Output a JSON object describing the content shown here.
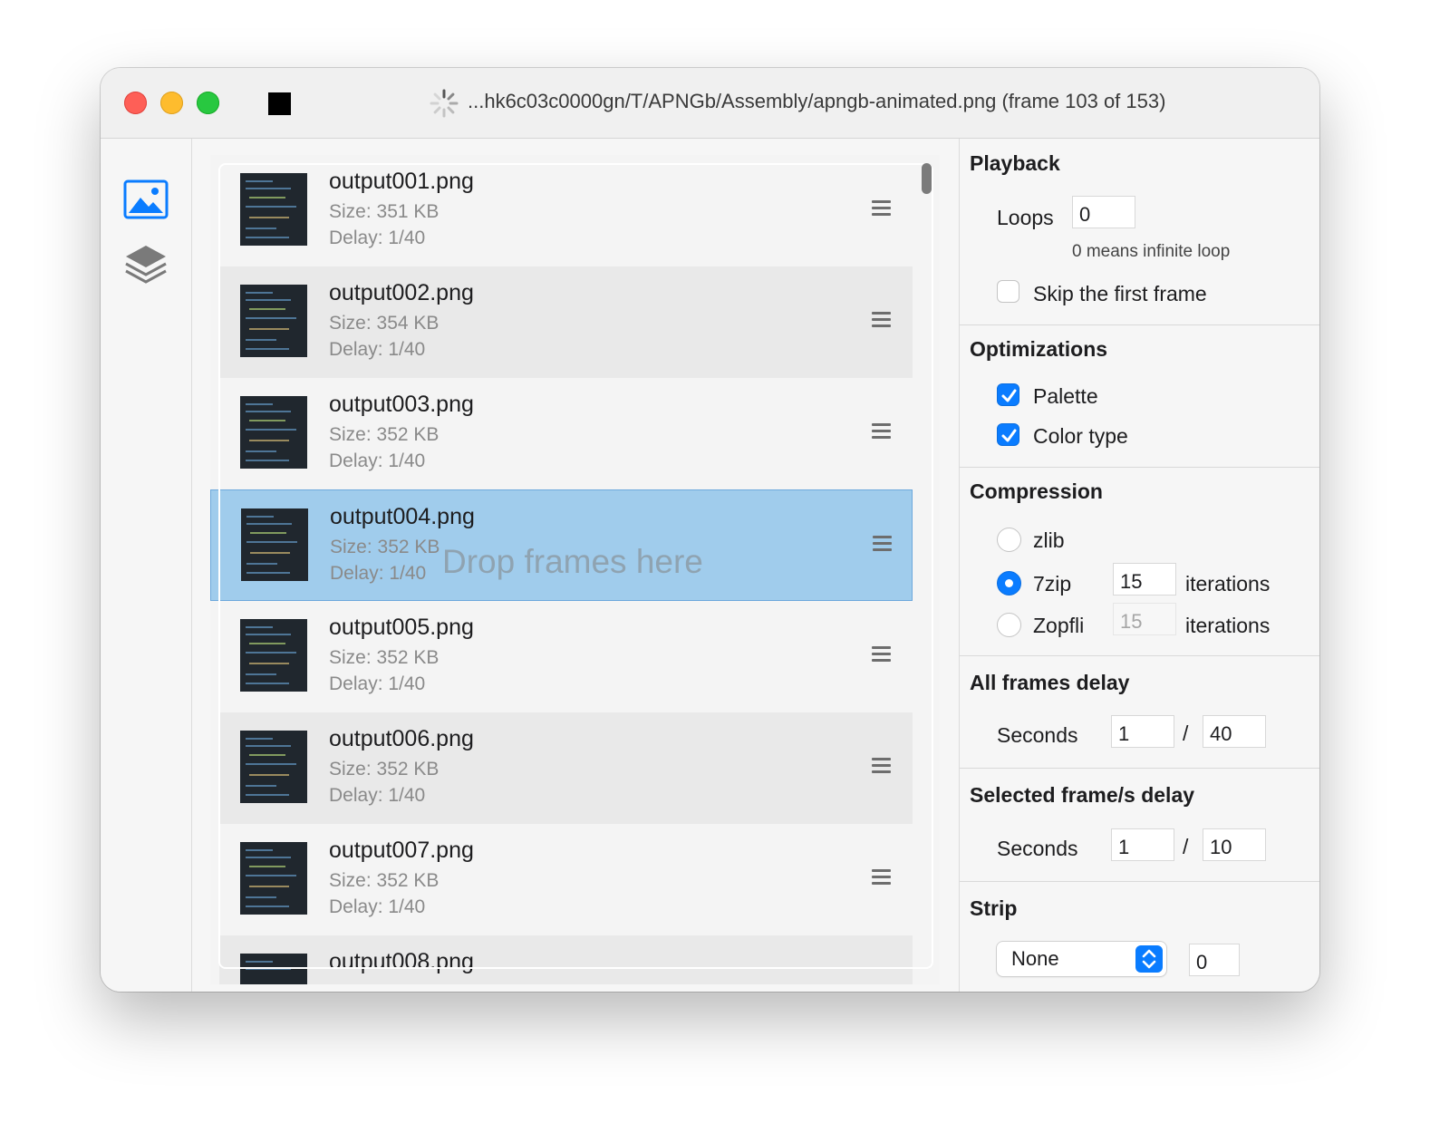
{
  "window": {
    "title": "...hk6c03c0000gn/T/APNGb/Assembly/apngb-animated.png (frame 103 of 153)"
  },
  "sidebar": {
    "items": [
      {
        "icon": "image-icon",
        "selected": true,
        "color": "#0a7cff"
      },
      {
        "icon": "layers-icon",
        "selected": false,
        "color": "#7a7a7a"
      }
    ]
  },
  "frames": {
    "drop_hint": "Drop frames here",
    "items": [
      {
        "name": "output001.png",
        "size": "Size: 351 KB",
        "delay": "Delay: 1/40",
        "selected": false
      },
      {
        "name": "output002.png",
        "size": "Size: 354 KB",
        "delay": "Delay: 1/40",
        "selected": false
      },
      {
        "name": "output003.png",
        "size": "Size: 352 KB",
        "delay": "Delay: 1/40",
        "selected": false
      },
      {
        "name": "output004.png",
        "size": "Size: 352 KB",
        "delay": "Delay: 1/40",
        "selected": true
      },
      {
        "name": "output005.png",
        "size": "Size: 352 KB",
        "delay": "Delay: 1/40",
        "selected": false
      },
      {
        "name": "output006.png",
        "size": "Size: 352 KB",
        "delay": "Delay: 1/40",
        "selected": false
      },
      {
        "name": "output007.png",
        "size": "Size: 352 KB",
        "delay": "Delay: 1/40",
        "selected": false
      },
      {
        "name": "output008.png",
        "size": "",
        "delay": "",
        "selected": false
      }
    ]
  },
  "inspector": {
    "playback": {
      "title": "Playback",
      "loops_label": "Loops",
      "loops_value": "0",
      "loops_hint": "0 means infinite loop",
      "skip_first_label": "Skip the first frame",
      "skip_first_checked": false
    },
    "optimizations": {
      "title": "Optimizations",
      "palette_label": "Palette",
      "palette_checked": true,
      "color_type_label": "Color type",
      "color_type_checked": true
    },
    "compression": {
      "title": "Compression",
      "zlib_label": "zlib",
      "sevenzip_label": "7zip",
      "sevenzip_iterations": "15",
      "zopfli_label": "Zopfli",
      "zopfli_iterations": "15",
      "iterations_label": "iterations",
      "selected": "7zip"
    },
    "all_frames_delay": {
      "title": "All frames delay",
      "seconds_label": "Seconds",
      "numerator": "1",
      "separator": "/",
      "denominator": "40"
    },
    "selected_frames_delay": {
      "title": "Selected frame/s delay",
      "seconds_label": "Seconds",
      "numerator": "1",
      "separator": "/",
      "denominator": "10"
    },
    "strip": {
      "title": "Strip",
      "selected": "None",
      "value": "0"
    }
  },
  "colors": {
    "accent": "#0a7cff",
    "selection": "#a0ccec"
  }
}
